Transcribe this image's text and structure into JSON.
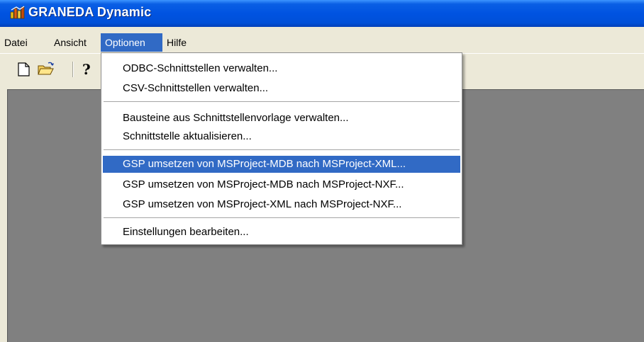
{
  "window": {
    "title": "GRANEDA Dynamic",
    "icon": "graneda-app-icon"
  },
  "menubar": {
    "items": [
      {
        "label": "Datei"
      },
      {
        "label": "Ansicht"
      },
      {
        "label": "Optionen",
        "active": true
      },
      {
        "label": "Hilfe"
      }
    ]
  },
  "toolbar": {
    "buttons": [
      {
        "icon": "new-document-icon"
      },
      {
        "icon": "open-folder-icon"
      },
      {
        "icon": "help-icon"
      }
    ]
  },
  "optionen_menu": {
    "items": [
      "ODBC-Schnittstellen verwalten...",
      "CSV-Schnittstellen verwalten...",
      "Bausteine aus Schnittstellenvorlage verwalten...",
      "Schnittstelle aktualisieren...",
      "GSP umsetzen von MSProject-MDB nach MSProject-XML...",
      "GSP umsetzen von MSProject-MDB nach MSProject-NXF...",
      "GSP umsetzen von MSProject-XML nach MSProject-NXF...",
      "Einstellungen bearbeiten..."
    ],
    "highlighted_index": 4
  },
  "colors": {
    "title_bar": "#0053e1",
    "menu_highlight": "#316ac5",
    "workspace": "#808080",
    "chrome": "#ece9d8"
  }
}
